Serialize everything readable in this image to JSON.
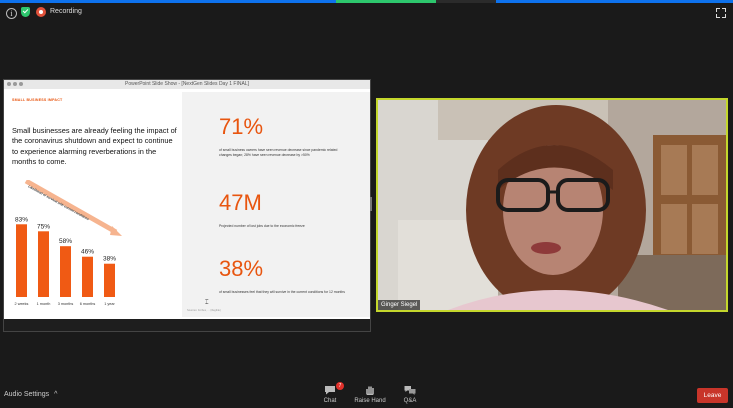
{
  "topbar": {
    "recording_label": "Recording",
    "icons": [
      "info-icon",
      "shield-check-icon",
      "record-icon",
      "fullscreen-icon"
    ]
  },
  "share": {
    "window_title": "PowerPoint Slide Show - [NextGen Slides Day 1 FINAL]",
    "slide": {
      "kicker": "SMALL BUSINESS IMPACT",
      "headline": "Small businesses are already feeling the impact of the coronavirus shutdown and expect to continue to experience alarming reverberations in the months to come.",
      "arrow_caption": "Likelihood of survival with current conditions",
      "stats": [
        {
          "value": "71%",
          "desc": "of small business owners have seen revenue decrease since pandemic related changes began; 28% have seen revenue decrease by >50%"
        },
        {
          "value": "47M",
          "desc": "Projected number of lost jobs due to the economic freeze"
        },
        {
          "value": "38%",
          "desc": "of small businesses feel that they will survive in the current conditions for 12 months"
        }
      ],
      "footnote": "Sources: Forbes, ... (illegible)"
    }
  },
  "chart_data": {
    "type": "bar",
    "categories": [
      "2 weeks",
      "1 month",
      "3 months",
      "6 months",
      "1 year"
    ],
    "values": [
      83,
      75,
      58,
      46,
      38
    ],
    "labels": [
      "83%",
      "75%",
      "58%",
      "46%",
      "38%"
    ],
    "ylim": [
      0,
      100
    ],
    "color": "#f05a14",
    "title": "",
    "xlabel": "",
    "ylabel": ""
  },
  "speaker": {
    "name": "Ginger Siegel",
    "border_color": "#c4d72c"
  },
  "bottombar": {
    "audio_settings_label": "Audio Settings",
    "chat_label": "Chat",
    "chat_badge": "7",
    "raise_hand_label": "Raise Hand",
    "qa_label": "Q&A",
    "leave_label": "Leave"
  }
}
